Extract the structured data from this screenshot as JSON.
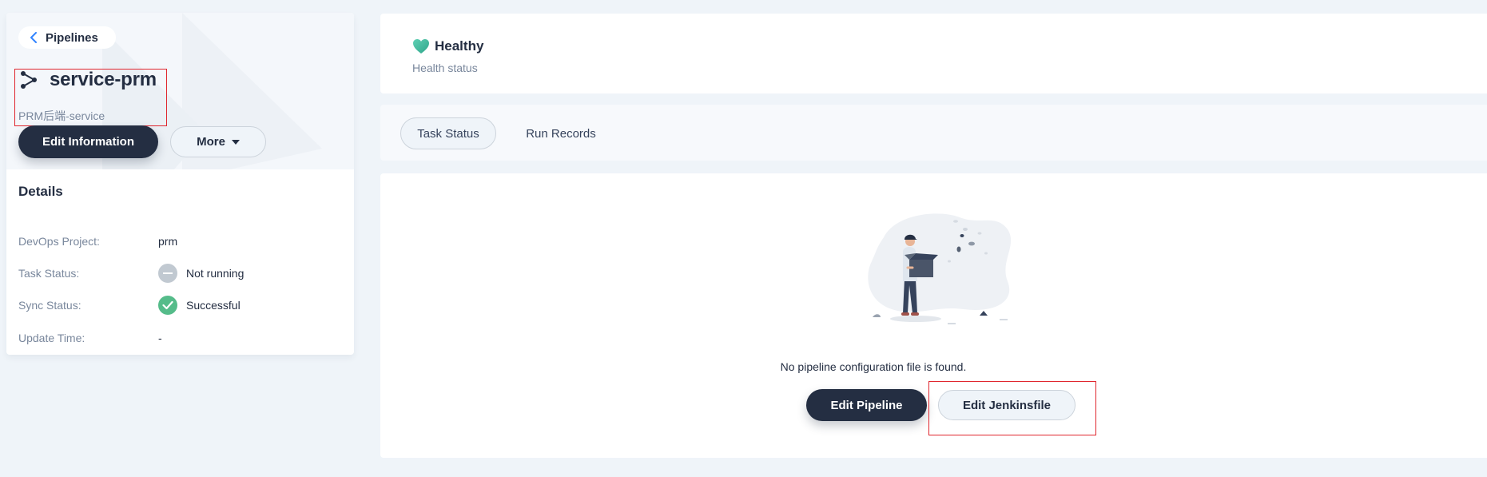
{
  "back": {
    "label": "Pipelines"
  },
  "pipeline": {
    "name": "service-prm",
    "description": "PRM后端-service"
  },
  "actions": {
    "edit_information": "Edit Information",
    "more": "More"
  },
  "details": {
    "title": "Details",
    "rows": [
      {
        "key": "DevOps Project:",
        "value": "prm"
      },
      {
        "key": "Task Status:",
        "value": "Not running"
      },
      {
        "key": "Sync Status:",
        "value": "Successful"
      },
      {
        "key": "Update Time:",
        "value": "-"
      }
    ]
  },
  "health": {
    "status": "Healthy",
    "label": "Health status"
  },
  "tabs": [
    {
      "label": "Task Status",
      "active": true
    },
    {
      "label": "Run Records",
      "active": false
    }
  ],
  "empty_state": {
    "message": "No pipeline configuration file is found.",
    "edit_pipeline": "Edit Pipeline",
    "edit_jenkinsfile": "Edit Jenkinsfile"
  },
  "colors": {
    "dark_button": "#242e42",
    "success": "#55bc8a",
    "idle": "#c1c9d1",
    "health_heart": "#3fbfa3",
    "highlight": "#e0262e"
  },
  "icons": {
    "back": "chevron-left-icon",
    "pipeline": "pipeline-icon",
    "more_caret": "caret-down-icon",
    "not_running": "not-running-icon",
    "success": "check-circle-icon",
    "health": "heart-icon"
  }
}
